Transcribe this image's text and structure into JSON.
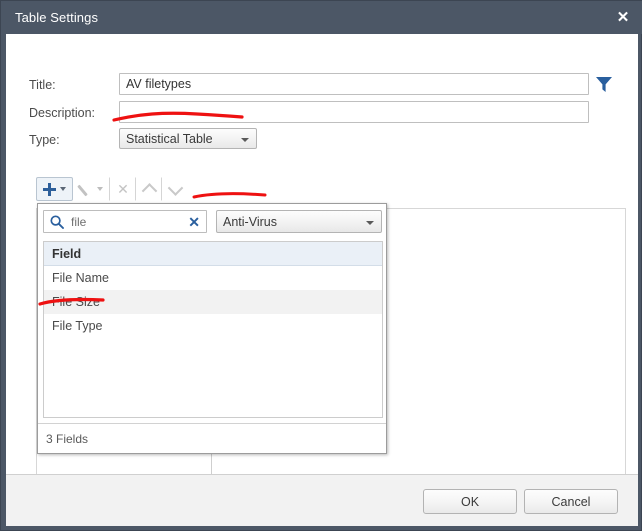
{
  "window": {
    "title": "Table Settings",
    "close_icon": "close-icon"
  },
  "form": {
    "title_label": "Title:",
    "title_value": "AV filetypes",
    "title_placeholder": "",
    "description_label": "Description:",
    "description_value": "",
    "description_placeholder": "",
    "type_label": "Type:",
    "type_value": "Statistical Table",
    "filter_icon": "filter-icon"
  },
  "toolbar": {
    "add_label": "",
    "add_icon": "plus-icon",
    "edit_icon": "pencil-icon",
    "delete_icon": "close-x-icon",
    "move_up_icon": "chevron-up-icon",
    "move_down_icon": "chevron-down-icon"
  },
  "picker": {
    "search_value": "file",
    "search_placeholder": "Search",
    "search_icon": "search-icon",
    "clear_icon": "clear-x-icon",
    "source_value": "Anti-Virus",
    "column_header": "Field",
    "fields": [
      {
        "label": "File Name"
      },
      {
        "label": "File Size"
      },
      {
        "label": "File Type"
      }
    ],
    "footer_count": "3 Fields"
  },
  "footer": {
    "ok_label": "OK",
    "cancel_label": "Cancel"
  },
  "colors": {
    "titlebar": "#4c5766",
    "accent_blue": "#2d5f9a",
    "annotation_red": "#ee1111",
    "header_row": "#eaf0f7",
    "alt_row": "#f2f2f2"
  }
}
